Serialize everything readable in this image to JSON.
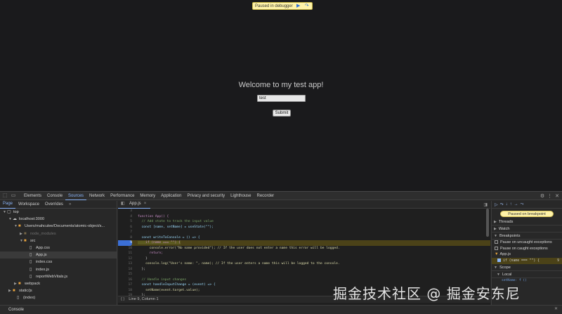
{
  "app": {
    "paused_banner": "Paused in debugger",
    "welcome": "Welcome to my test app!",
    "input_value": "test",
    "submit_label": "Submit"
  },
  "devtools": {
    "panel_tabs": [
      "Elements",
      "Console",
      "Sources",
      "Network",
      "Performance",
      "Memory",
      "Application",
      "Privacy and security",
      "Lighthouse",
      "Recorder"
    ],
    "active_panel": "Sources",
    "navigator_tabs": [
      "Page",
      "Workspace",
      "Overrides"
    ],
    "tree": [
      {
        "label": "top",
        "type": "frame"
      },
      {
        "label": "localhost:3000",
        "type": "cloud"
      },
      {
        "label": "Users/mahculee/Documents/atomic-object/s...",
        "type": "folder"
      },
      {
        "label": "node_modules",
        "type": "folder-faded"
      },
      {
        "label": "src",
        "type": "folder"
      },
      {
        "label": "App.css",
        "type": "file"
      },
      {
        "label": "App.js",
        "type": "file",
        "selected": true
      },
      {
        "label": "index.css",
        "type": "file"
      },
      {
        "label": "index.js",
        "type": "file"
      },
      {
        "label": "reportWebVitals.js",
        "type": "file"
      },
      {
        "label": "webpack",
        "type": "folder"
      },
      {
        "label": "static/js",
        "type": "folder"
      },
      {
        "label": "(index)",
        "type": "file"
      }
    ],
    "editor_tab": "App.js",
    "code_lines": [
      {
        "n": "3",
        "text": ""
      },
      {
        "n": "4",
        "text": "function App() {"
      },
      {
        "n": "5",
        "text": "  // Add state to track the input value"
      },
      {
        "n": "6",
        "text": "  const [name, setName] = useState(\"\");"
      },
      {
        "n": "7",
        "text": ""
      },
      {
        "n": "8",
        "text": "  const writeToConsole = () => {"
      },
      {
        "n": "9",
        "text": "    if (name === \"\") {"
      },
      {
        "n": "10",
        "text": "      console.error(\"No name provided\"); // If the user does not enter a name this error will be logged."
      },
      {
        "n": "11",
        "text": "      return;"
      },
      {
        "n": "12",
        "text": "    }"
      },
      {
        "n": "13",
        "text": "    console.log(\"User's name: \", name); // If the user enters a name this will be logged to the console."
      },
      {
        "n": "14",
        "text": "  };"
      },
      {
        "n": "15",
        "text": ""
      },
      {
        "n": "16",
        "text": "  // Handle input changes"
      },
      {
        "n": "17",
        "text": "  const handleInputChange = (event) => {"
      },
      {
        "n": "18",
        "text": "    setName(event.target.value);"
      },
      {
        "n": "19",
        "text": "  };"
      }
    ],
    "status": "Line 9, Column 1",
    "debugger": {
      "paused_label": "Paused on breakpoint",
      "sections": [
        "Threads",
        "Watch",
        "Breakpoints"
      ],
      "checkboxes": [
        "Pause on uncaught exceptions",
        "Pause on caught exceptions"
      ],
      "bp_file": "App.js",
      "bp_code": "if (name === \"\") {",
      "bp_line": "9",
      "scope_sections": [
        "Scope",
        "Local"
      ],
      "scope_var": "setName: f ()"
    },
    "drawer_tab": "Console"
  },
  "watermark": "掘金技术社区 @ 掘金安东尼",
  "colors": {
    "accent": "#8ab4f8",
    "breakpoint_line": "#4b4218",
    "banner": "#fff3a8"
  }
}
